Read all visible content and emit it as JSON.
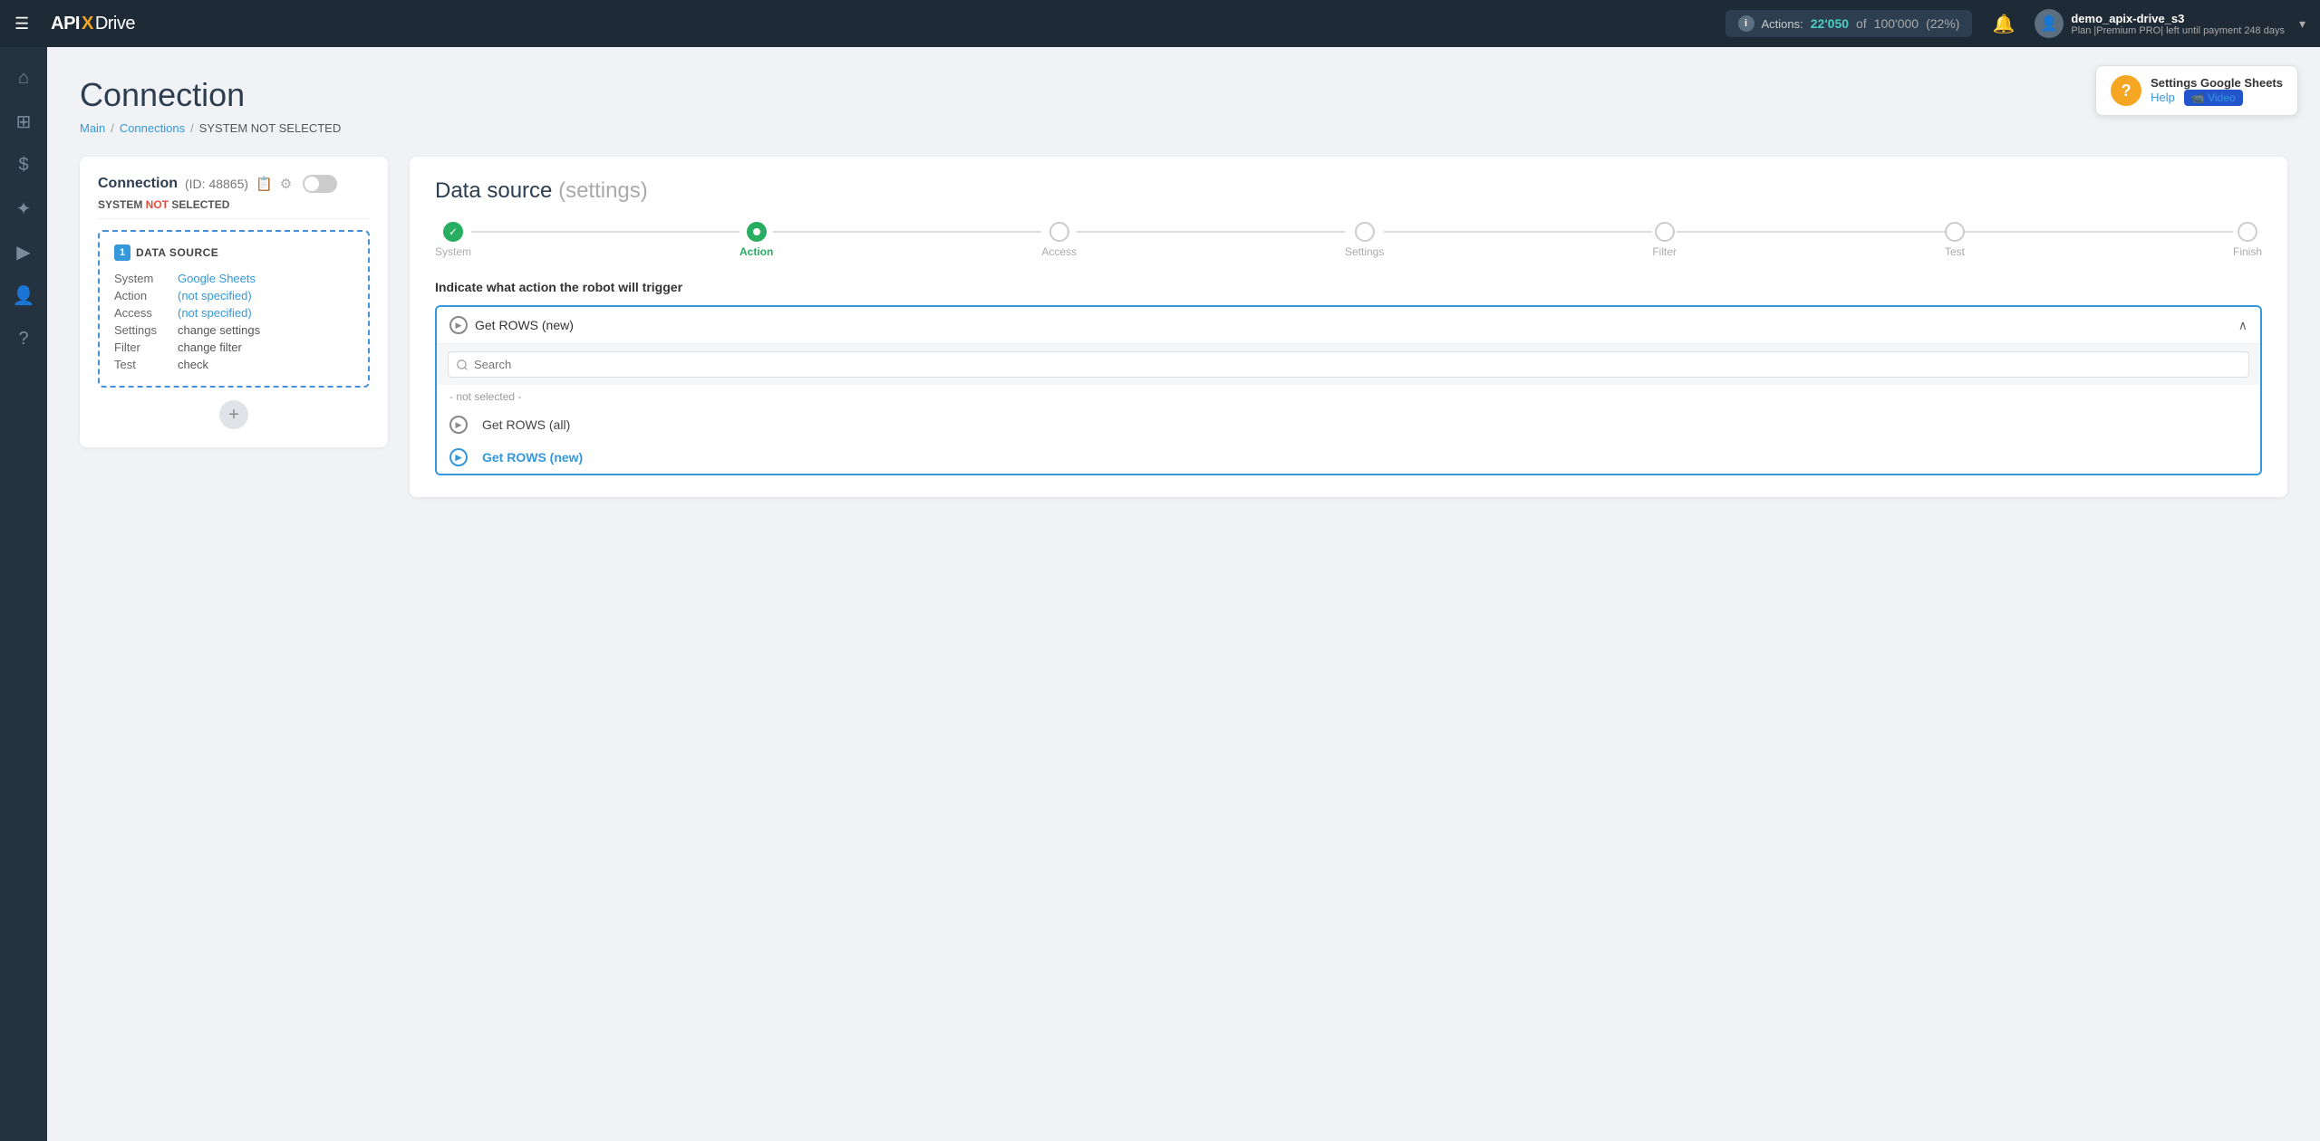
{
  "topnav": {
    "logo": {
      "api": "API",
      "x": "X",
      "drive": "Drive"
    },
    "hamburger_icon": "☰",
    "actions": {
      "label": "Actions:",
      "count": "22'050",
      "of_label": "of",
      "limit": "100'000",
      "pct": "(22%)"
    },
    "bell_icon": "🔔",
    "user": {
      "username": "demo_apix-drive_s3",
      "plan": "Plan |Premium PRO| left until payment 248 days",
      "chevron": "▾"
    }
  },
  "sidebar": {
    "items": [
      {
        "icon": "⌂",
        "name": "home"
      },
      {
        "icon": "⊞",
        "name": "grid"
      },
      {
        "icon": "$",
        "name": "billing"
      },
      {
        "icon": "✦",
        "name": "plugins"
      },
      {
        "icon": "▶",
        "name": "play"
      },
      {
        "icon": "👤",
        "name": "account"
      },
      {
        "icon": "?",
        "name": "help"
      }
    ]
  },
  "help_box": {
    "title": "Settings Google Sheets",
    "help_label": "Help",
    "video_label": "📹 Video"
  },
  "page": {
    "title": "Connection",
    "breadcrumb": {
      "main": "Main",
      "connections": "Connections",
      "current": "SYSTEM NOT SELECTED"
    }
  },
  "left_card": {
    "connection_title": "Connection",
    "connection_id": "(ID: 48865)",
    "copy_icon": "📋",
    "settings_icon": "⚙",
    "system_label": "SYSTEM",
    "not_label": " NOT",
    "selected_label": " SELECTED",
    "datasource": {
      "num": "1",
      "label": "DATA SOURCE",
      "rows": [
        {
          "key": "System",
          "value": "Google Sheets",
          "link": true
        },
        {
          "key": "Action",
          "value": "(not specified)",
          "link": true
        },
        {
          "key": "Access",
          "value": "(not specified)",
          "link": true
        },
        {
          "key": "Settings",
          "value": "change settings",
          "link": false
        },
        {
          "key": "Filter",
          "value": "change filter",
          "link": false
        },
        {
          "key": "Test",
          "value": "check",
          "link": false
        }
      ]
    },
    "add_icon": "+"
  },
  "right_card": {
    "title": "Data source",
    "title_paren": "(settings)",
    "steps": [
      {
        "label": "System",
        "state": "done"
      },
      {
        "label": "Action",
        "state": "active"
      },
      {
        "label": "Access",
        "state": "idle"
      },
      {
        "label": "Settings",
        "state": "idle"
      },
      {
        "label": "Filter",
        "state": "idle"
      },
      {
        "label": "Test",
        "state": "idle"
      },
      {
        "label": "Finish",
        "state": "idle"
      }
    ],
    "action_prompt": "Indicate what action the robot will trigger",
    "dropdown": {
      "selected_value": "Get ROWS (new)",
      "search_placeholder": "Search",
      "not_selected_label": "- not selected -",
      "options": [
        {
          "label": "Get ROWS (all)",
          "selected": false
        },
        {
          "label": "Get ROWS (new)",
          "selected": true
        }
      ]
    }
  }
}
